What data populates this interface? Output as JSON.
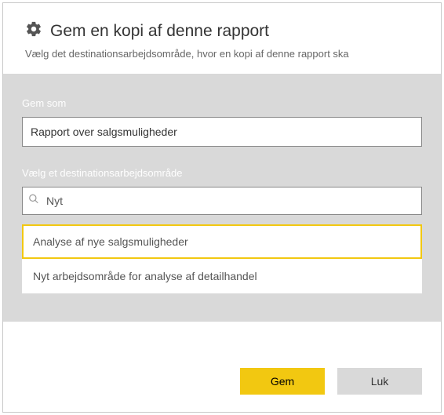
{
  "header": {
    "title": "Gem en kopi af denne rapport",
    "subtitle": "Vælg det destinationsarbejdsområde, hvor en kopi af denne rapport ska"
  },
  "form": {
    "save_as_label": "Gem som",
    "report_name": "Rapport over salgsmuligheder",
    "workspace_label": "Vælg et destinationsarbejdsområde",
    "search_value": "Nyt",
    "options": [
      {
        "label": "Analyse af nye salgsmuligheder",
        "selected": true
      },
      {
        "label": "Nyt arbejdsområde for analyse af detailhandel",
        "selected": false
      }
    ]
  },
  "footer": {
    "save": "Gem",
    "close": "Luk"
  },
  "colors": {
    "accent": "#f2c811",
    "body_bg": "#d9d9d9"
  }
}
